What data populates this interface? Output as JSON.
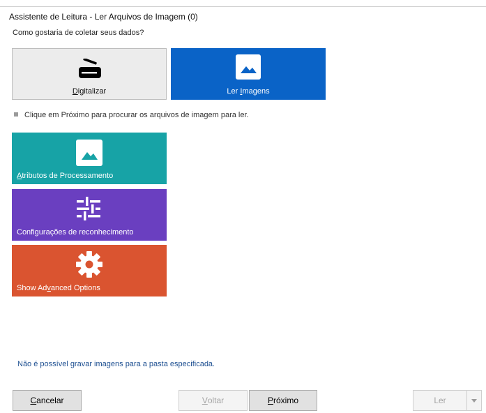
{
  "window": {
    "title": "Assistente de Leitura - Ler Arquivos de Imagem (0)"
  },
  "question": "Como gostaria de coletar seus dados?",
  "sources": [
    {
      "label_pre": "",
      "label_ul": "D",
      "label_post": "igitalizar",
      "icon": "scanner-icon",
      "selected": false
    },
    {
      "label_pre": "Ler ",
      "label_ul": "I",
      "label_post": "magens",
      "icon": "image-icon",
      "selected": true
    }
  ],
  "hint": "Clique em Próximo para procurar os arquivos de imagem para ler.",
  "options": [
    {
      "label_pre": "",
      "label_ul": "A",
      "label_post": "tributos de Processamento",
      "icon": "image-icon",
      "color": "#17a3a6"
    },
    {
      "label_pre": "Configurações de reconhecimento",
      "label_ul": "",
      "label_post": "",
      "icon": "sliders-icon",
      "color": "#6a3fc0"
    },
    {
      "label_pre": "Show Ad",
      "label_ul": "v",
      "label_post": "anced Options",
      "icon": "gear-icon",
      "color": "#da5430"
    }
  ],
  "error": "Não é possível gravar imagens para a pasta especificada.",
  "buttons": {
    "cancel": {
      "label_ul": "C",
      "label_post": "ancelar"
    },
    "back": {
      "label_ul": "V",
      "label_post": "oltar",
      "enabled": false
    },
    "next": {
      "label_ul": "P",
      "label_post": "róximo"
    },
    "read": {
      "label": "Ler",
      "enabled": false
    }
  }
}
